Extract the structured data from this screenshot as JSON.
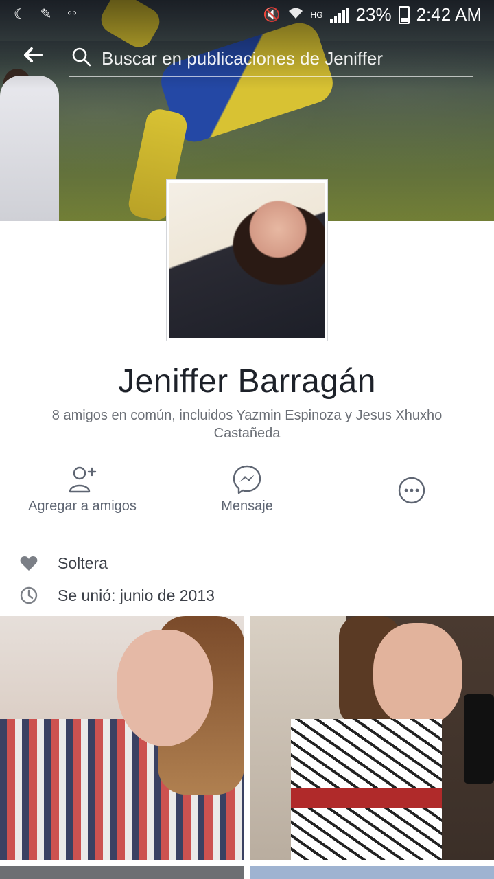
{
  "status_bar": {
    "battery": "23%",
    "time": "2:42 AM",
    "network": "HG"
  },
  "search": {
    "placeholder": "Buscar en publicaciones de Jeniffer"
  },
  "profile": {
    "name": "Jeniffer Barragán",
    "mutual_friends": "8 amigos en común, incluidos Yazmin Espinoza y Jesus Xhuxho Castañeda"
  },
  "actions": {
    "add_friend": "Agregar a amigos",
    "message": "Mensaje"
  },
  "info": {
    "relationship": "Soltera",
    "joined": "Se unió: junio de 2013"
  },
  "colors": {
    "text_dark": "#1d2129",
    "text_muted": "#6b6f76",
    "icon_gray": "#5e6572"
  }
}
